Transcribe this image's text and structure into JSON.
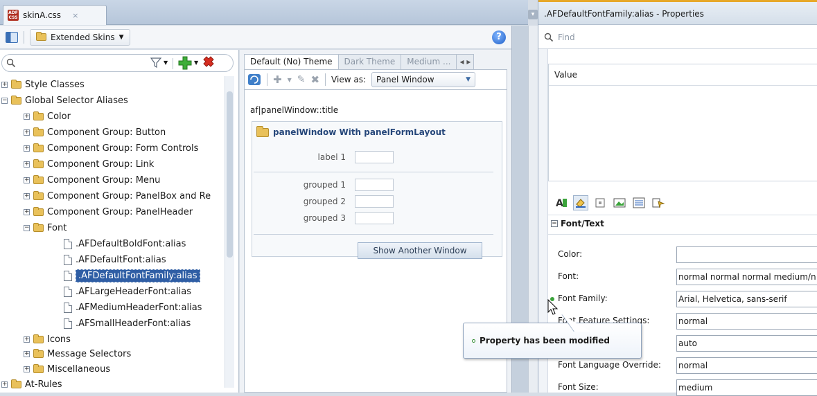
{
  "editor": {
    "tab_title": "skinA.css",
    "tab_close": "×",
    "badge": "ADF CSS",
    "skins_combo": "Extended Skins",
    "help": "?"
  },
  "tree": {
    "search_placeholder": "",
    "items": [
      {
        "label": "Style Classes"
      },
      {
        "label": "Global Selector Aliases"
      },
      {
        "label": "Color"
      },
      {
        "label": "Component Group: Button"
      },
      {
        "label": "Component Group: Form Controls"
      },
      {
        "label": "Component Group: Link"
      },
      {
        "label": "Component Group: Menu"
      },
      {
        "label": "Component Group: PanelBox and Re"
      },
      {
        "label": "Component Group: PanelHeader"
      },
      {
        "label": "Font"
      },
      {
        "label": ".AFDefaultBoldFont:alias"
      },
      {
        "label": ".AFDefaultFont:alias"
      },
      {
        "label": ".AFDefaultFontFamily:alias"
      },
      {
        "label": ".AFLargeHeaderFont:alias"
      },
      {
        "label": ".AFMediumHeaderFont:alias"
      },
      {
        "label": ".AFSmallHeaderFont:alias"
      },
      {
        "label": "Icons"
      },
      {
        "label": "Message Selectors"
      },
      {
        "label": "Miscellaneous"
      },
      {
        "label": "At-Rules"
      }
    ]
  },
  "preview": {
    "tabs": [
      "Default (No) Theme",
      "Dark Theme",
      "Medium ..."
    ],
    "view_as_label": "View as:",
    "view_as_value": "Panel Window",
    "selector": "af|panelWindow::title",
    "panel_title": "panelWindow With panelFormLayout",
    "form": {
      "label1": "label 1",
      "grouped1": "grouped 1",
      "grouped2": "grouped 2",
      "grouped3": "grouped 3"
    },
    "button": "Show Another Window"
  },
  "properties": {
    "title": ".AFDefaultFontFamily:alias - Properties",
    "find_placeholder": "Find",
    "value_header": "Value",
    "section": "Font/Text",
    "rows": [
      {
        "label": "Color:",
        "value": ""
      },
      {
        "label": "Font:",
        "value": "normal normal normal medium/n"
      },
      {
        "label": "Font Family:",
        "value": "Arial, Helvetica, sans-serif"
      },
      {
        "label": "Font Feature Settings:",
        "value": "normal"
      },
      {
        "label": "",
        "value": "auto"
      },
      {
        "label": "Font Language Override:",
        "value": "normal"
      },
      {
        "label": "Font Size:",
        "value": "medium"
      }
    ]
  },
  "tooltip": {
    "text": "Property has been modified"
  }
}
